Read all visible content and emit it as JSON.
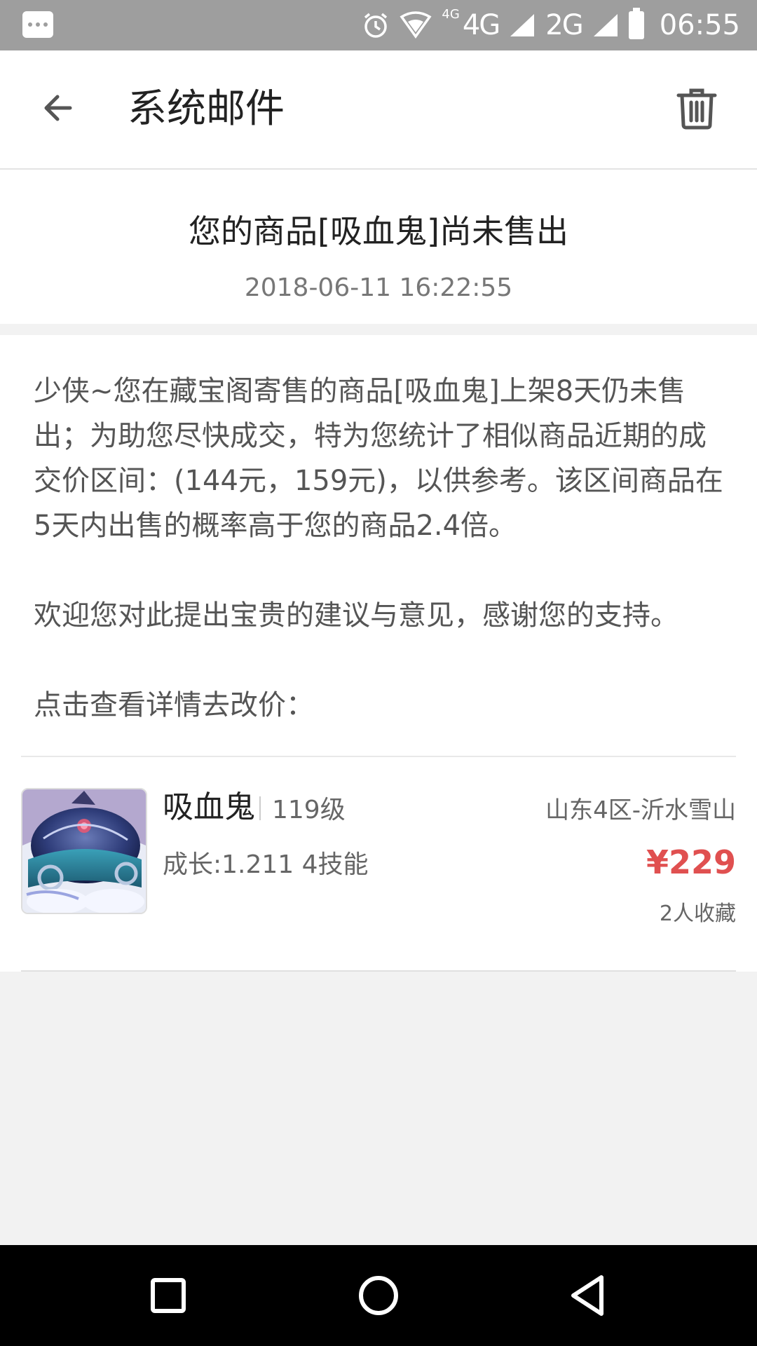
{
  "status_bar": {
    "network_small": "4G",
    "network_1": "4G",
    "network_2": "2G",
    "time": "06:55"
  },
  "header": {
    "title": "系统邮件"
  },
  "mail": {
    "subject": "您的商品[吸血鬼]尚未售出",
    "date": "2018-06-11 16:22:55",
    "paragraphs": [
      "少侠~您在藏宝阁寄售的商品[吸血鬼]上架8天仍未售出；为助您尽快成交，特为您统计了相似商品近期的成交价区间：(144元，159元)，以供参考。该区间商品在5天内出售的概率高于您的商品2.4倍。",
      "欢迎您对此提出宝贵的建议与意见，感谢您的支持。",
      "点击查看详情去改价："
    ]
  },
  "product": {
    "name": "吸血鬼",
    "level": "119级",
    "server": "山东4区-沂水雪山",
    "detail": "成长:1.211 4技能",
    "price": "¥229",
    "favorites": "2人收藏"
  }
}
